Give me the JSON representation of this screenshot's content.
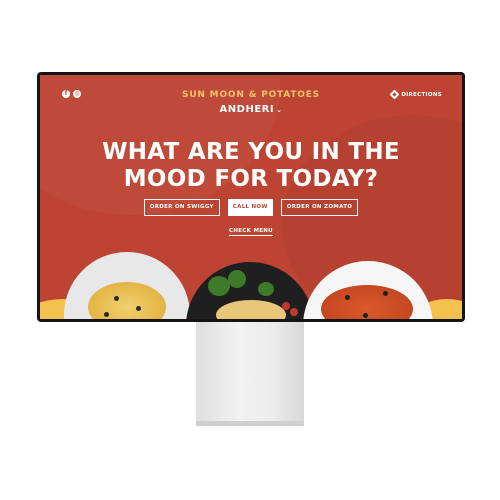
{
  "header": {
    "social_icons": [
      {
        "name": "facebook-icon",
        "glyph": "f"
      },
      {
        "name": "instagram-icon",
        "glyph": "◎"
      }
    ],
    "brand": "SUN MOON & POTATOES",
    "location": "ANDHERI",
    "location_chevron": "⌄",
    "directions_label": "DIRECTIONS"
  },
  "hero": {
    "headline_line1": "WHAT ARE YOU IN THE",
    "headline_line2": "MOOD FOR TODAY?",
    "buttons": {
      "swiggy": "ORDER ON SWIGGY",
      "call": "CALL NOW",
      "zomato": "ORDER ON ZOMATO"
    },
    "check_menu": "CHECK MENU"
  },
  "colors": {
    "background": "#bd4433",
    "brand_yellow": "#f2c36b",
    "accent_yellow": "#f2c14e",
    "text": "#ffffff"
  }
}
